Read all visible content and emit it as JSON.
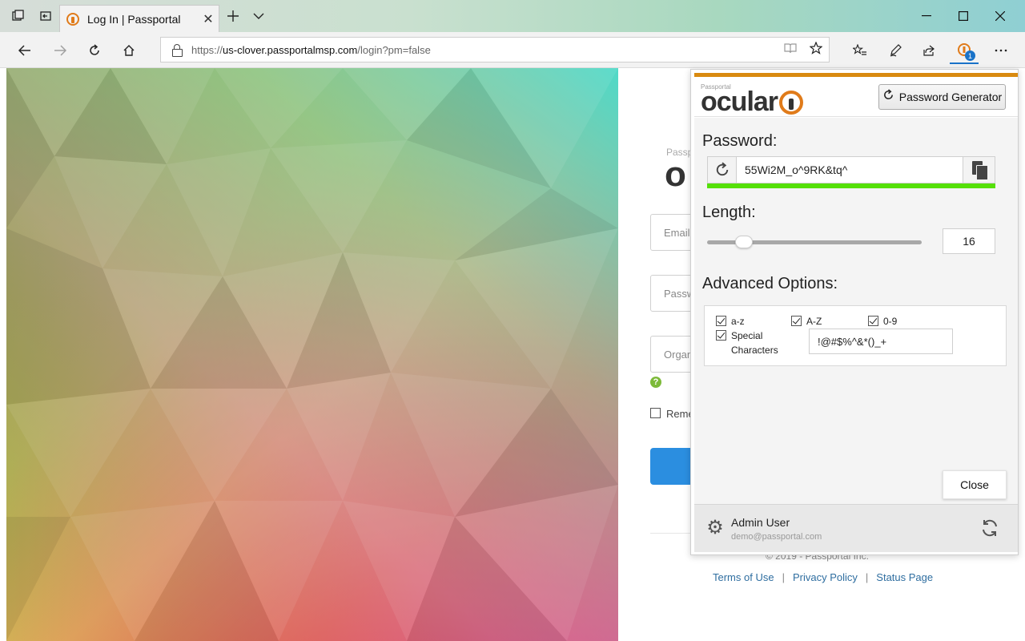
{
  "browser": {
    "tab_title": "Log In | Passportal",
    "url_prefix": "https://",
    "url_host": "us-clover.passportalmsp.com",
    "url_path": "/login?pm=false",
    "extension_badge": "1"
  },
  "login_page": {
    "brand_small": "Passp",
    "logo_partial": "o",
    "email_placeholder": "Email",
    "password_placeholder": "Passw",
    "organization_placeholder": "Organ",
    "remember_label": "Reme",
    "copyright": "© 2019 - Passportal Inc.",
    "links": [
      "Terms of Use",
      "Privacy Policy",
      "Status Page"
    ],
    "separator": "|"
  },
  "popup": {
    "brand_small": "Passportal",
    "brand_word": "ocular",
    "generator_button": "Password Generator",
    "password_label": "Password:",
    "password_value": "55Wi2M_o^9RK&tq^",
    "strength_fraction": 1.0,
    "length_label": "Length:",
    "length_value": "16",
    "length_min": 8,
    "length_max": 64,
    "advanced_label": "Advanced Options:",
    "options": [
      {
        "label": "a-z",
        "checked": true
      },
      {
        "label": "A-Z",
        "checked": true
      },
      {
        "label": "0-9",
        "checked": true
      },
      {
        "label_line1": "Special",
        "label_line2": "Characters",
        "checked": true
      }
    ],
    "special_chars": "!@#$%^&*()_+",
    "close_label": "Close",
    "user_name": "Admin User",
    "user_email": "demo@passportal.com"
  },
  "colors": {
    "accent_orange": "#e07b1a",
    "strength_green": "#55e008",
    "login_blue": "#2b8ee0"
  }
}
